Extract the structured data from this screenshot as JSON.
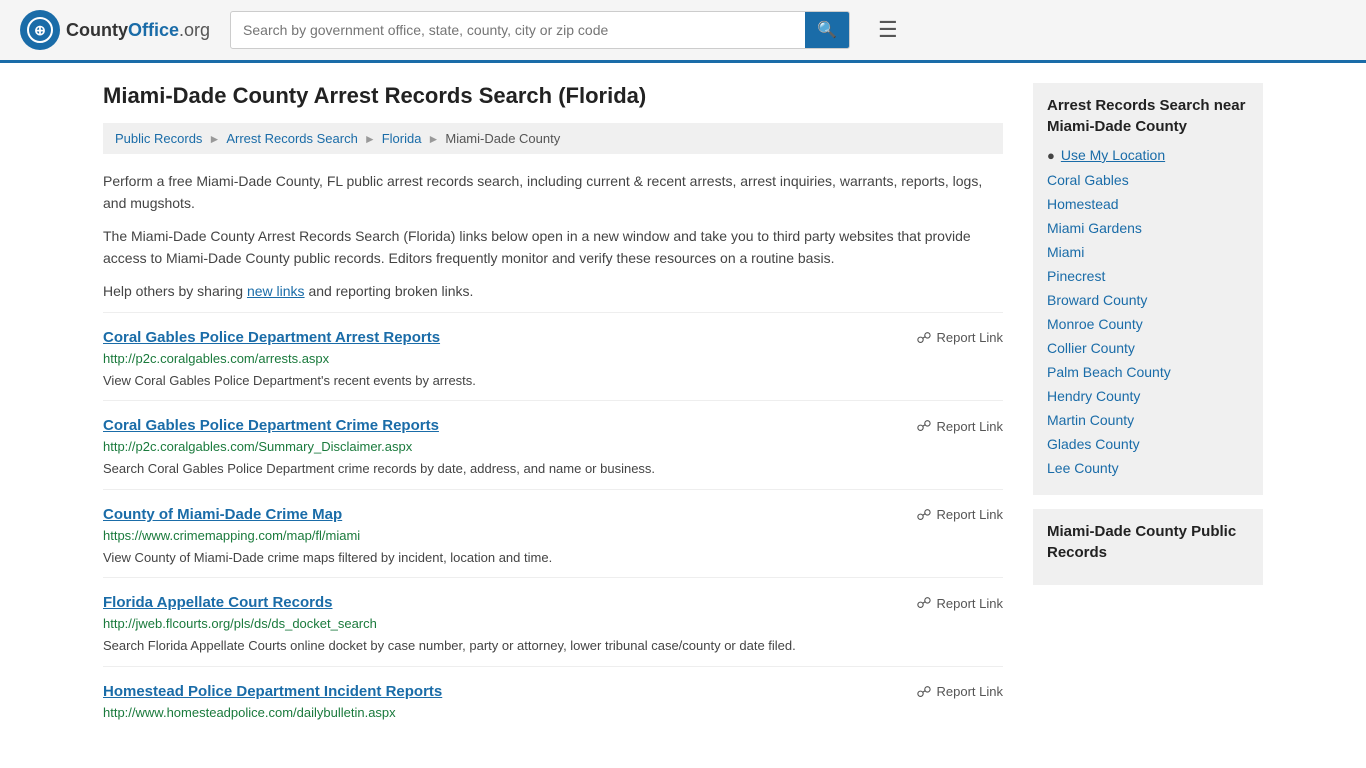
{
  "header": {
    "logo_text": "CountyOffice",
    "logo_domain": ".org",
    "search_placeholder": "Search by government office, state, county, city or zip code"
  },
  "page": {
    "title": "Miami-Dade County Arrest Records Search (Florida)"
  },
  "breadcrumb": {
    "items": [
      "Public Records",
      "Arrest Records Search",
      "Florida",
      "Miami-Dade County"
    ]
  },
  "description": [
    "Perform a free Miami-Dade County, FL public arrest records search, including current & recent arrests, arrest inquiries, warrants, reports, logs, and mugshots.",
    "The Miami-Dade County Arrest Records Search (Florida) links below open in a new window and take you to third party websites that provide access to Miami-Dade County public records. Editors frequently monitor and verify these resources on a routine basis.",
    "Help others by sharing new links and reporting broken links."
  ],
  "results": [
    {
      "title": "Coral Gables Police Department Arrest Reports",
      "url": "http://p2c.coralgables.com/arrests.aspx",
      "description": "View Coral Gables Police Department's recent events by arrests."
    },
    {
      "title": "Coral Gables Police Department Crime Reports",
      "url": "http://p2c.coralgables.com/Summary_Disclaimer.aspx",
      "description": "Search Coral Gables Police Department crime records by date, address, and name or business."
    },
    {
      "title": "County of Miami-Dade Crime Map",
      "url": "https://www.crimemapping.com/map/fl/miami",
      "description": "View County of Miami-Dade crime maps filtered by incident, location and time."
    },
    {
      "title": "Florida Appellate Court Records",
      "url": "http://jweb.flcourts.org/pls/ds/ds_docket_search",
      "description": "Search Florida Appellate Courts online docket by case number, party or attorney, lower tribunal case/county or date filed."
    },
    {
      "title": "Homestead Police Department Incident Reports",
      "url": "http://www.homesteadpolice.com/dailybulletin.aspx",
      "description": ""
    }
  ],
  "report_link_label": "Report Link",
  "sidebar": {
    "nearby_title": "Arrest Records Search near Miami-Dade County",
    "use_my_location": "Use My Location",
    "nearby_links": [
      "Coral Gables",
      "Homestead",
      "Miami Gardens",
      "Miami",
      "Pinecrest",
      "Broward County",
      "Monroe County",
      "Collier County",
      "Palm Beach County",
      "Hendry County",
      "Martin County",
      "Glades County",
      "Lee County"
    ],
    "public_records_title": "Miami-Dade County Public Records"
  }
}
